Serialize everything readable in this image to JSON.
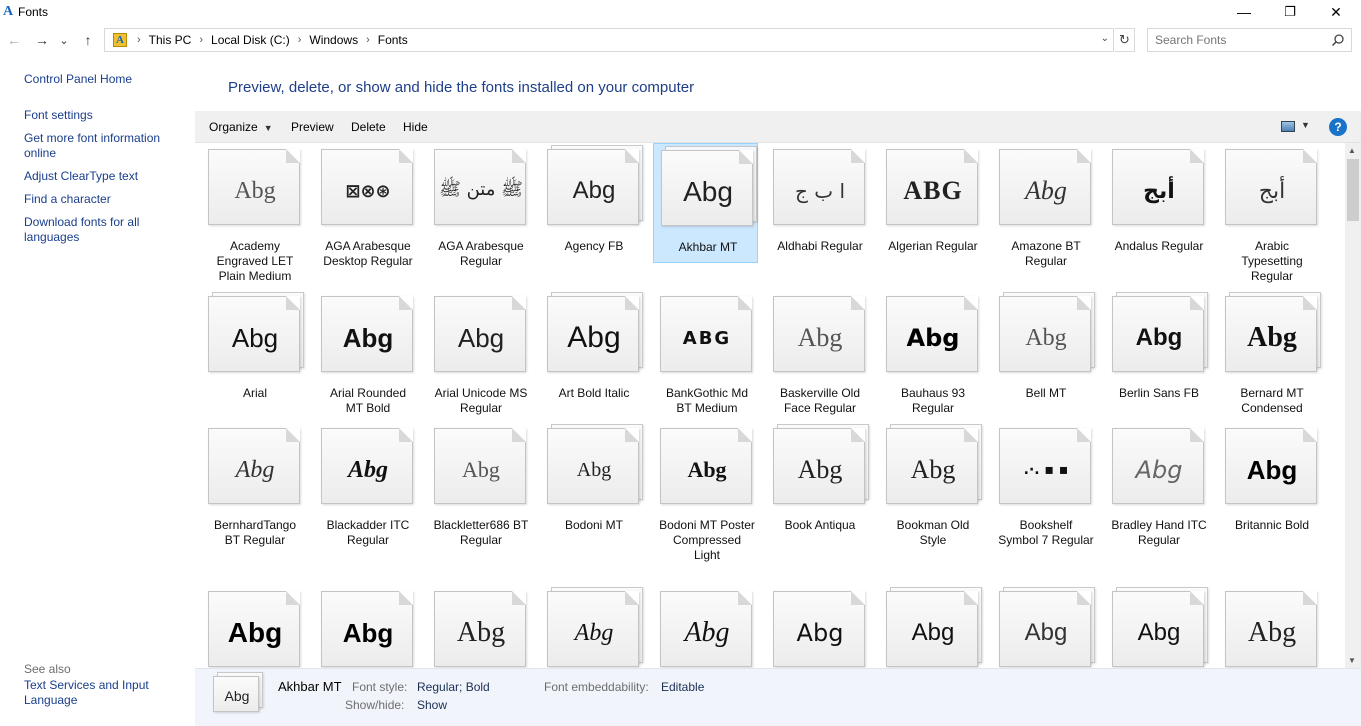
{
  "window": {
    "title": "Fonts",
    "minimize": "—",
    "maximize": "❐",
    "close": "✕"
  },
  "nav": {
    "back": "←",
    "forward": "→",
    "recent": "⌄",
    "up": "↑"
  },
  "address": {
    "crumbs": [
      "This PC",
      "Local Disk (C:)",
      "Windows",
      "Fonts"
    ],
    "separator": "›",
    "dropdown": "⌄",
    "refresh": "↻"
  },
  "search": {
    "placeholder": "Search Fonts"
  },
  "sidebar": {
    "control_panel_home": "Control Panel Home",
    "font_settings": "Font settings",
    "more_info": "Get more font information online",
    "cleartype": "Adjust ClearType text",
    "find_char": "Find a character",
    "download": "Download fonts for all languages",
    "see_also": "See also",
    "text_services": "Text Services and Input Language"
  },
  "main": {
    "heading": "Preview, delete, or show and hide the fonts installed on your computer",
    "commands": {
      "organize": "Organize",
      "preview": "Preview",
      "delete": "Delete",
      "hide": "Hide",
      "help": "?"
    },
    "row1": [
      {
        "sample": "Abg",
        "label": "Academy Engraved LET Plain Medium"
      },
      {
        "sample": "⊠⊗⊛",
        "label": "AGA Arabesque Desktop Regular"
      },
      {
        "sample": "ﷺ متن ﷺ",
        "label": "AGA Arabesque Regular"
      },
      {
        "sample": "Abg",
        "label": "Agency FB"
      },
      {
        "sample": "Abg",
        "label": "Akhbar MT"
      },
      {
        "sample": "ا ب ج",
        "label": "Aldhabi Regular"
      },
      {
        "sample": "ABG",
        "label": "Algerian Regular"
      },
      {
        "sample": "Abg",
        "label": "Amazone BT Regular"
      },
      {
        "sample": "أبج",
        "label": "Andalus Regular"
      },
      {
        "sample": "أبج",
        "label": "Arabic Typesetting Regular"
      }
    ],
    "row2": [
      {
        "sample": "Abg",
        "label": "Arial"
      },
      {
        "sample": "Abg",
        "label": "Arial Rounded MT Bold"
      },
      {
        "sample": "Abg",
        "label": "Arial Unicode MS Regular"
      },
      {
        "sample": "Abg",
        "label": "Art Bold Italic"
      },
      {
        "sample": "ABG",
        "label": "BankGothic Md BT Medium"
      },
      {
        "sample": "Abg",
        "label": "Baskerville Old Face Regular"
      },
      {
        "sample": "Abg",
        "label": "Bauhaus 93 Regular"
      },
      {
        "sample": "Abg",
        "label": "Bell MT"
      },
      {
        "sample": "Abg",
        "label": "Berlin Sans FB"
      },
      {
        "sample": "Abg",
        "label": "Bernard MT Condensed"
      }
    ],
    "row3": [
      {
        "sample": "Abg",
        "label": "BernhardTango BT Regular"
      },
      {
        "sample": "Abg",
        "label": "Blackadder ITC Regular"
      },
      {
        "sample": "Abg",
        "label": "Blackletter686 BT Regular"
      },
      {
        "sample": "Abg",
        "label": "Bodoni MT"
      },
      {
        "sample": "Abg",
        "label": "Bodoni MT Poster Compressed Light"
      },
      {
        "sample": "Abg",
        "label": "Book Antiqua"
      },
      {
        "sample": "Abg",
        "label": "Bookman Old Style"
      },
      {
        "sample": ".·.  ▪  ▪",
        "label": "Bookshelf Symbol 7 Regular"
      },
      {
        "sample": "Abg",
        "label": "Bradley Hand ITC Regular"
      },
      {
        "sample": "Abg",
        "label": "Britannic Bold"
      }
    ],
    "row4": [
      {
        "sample": "Abg"
      },
      {
        "sample": "Abg"
      },
      {
        "sample": "Abg"
      },
      {
        "sample": "Abg"
      },
      {
        "sample": "Abg"
      },
      {
        "sample": "Abg"
      },
      {
        "sample": "Abg"
      },
      {
        "sample": "Abg"
      },
      {
        "sample": "Abg"
      },
      {
        "sample": "Abg"
      }
    ]
  },
  "details": {
    "sample": "Abg",
    "name": "Akhbar MT",
    "font_style_label": "Font style:",
    "font_style_value": "Regular; Bold",
    "show_hide_label": "Show/hide:",
    "show_hide_value": "Show",
    "embed_label": "Font embeddability:",
    "embed_value": "Editable"
  },
  "scroll": {
    "up": "▲",
    "down": "▼"
  }
}
